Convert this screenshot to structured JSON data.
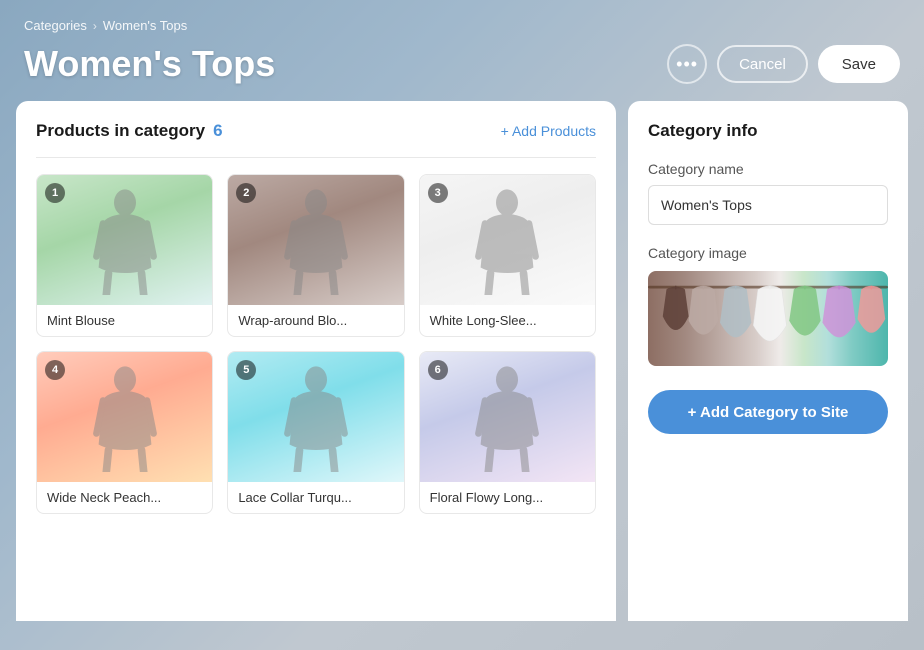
{
  "breadcrumb": {
    "parent": "Categories",
    "separator": "›",
    "current": "Women's Tops"
  },
  "page": {
    "title": "Women's Tops"
  },
  "header_actions": {
    "more_label": "•••",
    "cancel_label": "Cancel",
    "save_label": "Save"
  },
  "products_panel": {
    "title": "Products in category",
    "count": "6",
    "add_label": "+ Add Products"
  },
  "products": [
    {
      "id": 1,
      "number": "1",
      "name": "Mint Blouse",
      "img_class": "img-mint"
    },
    {
      "id": 2,
      "number": "2",
      "name": "Wrap-around Blo...",
      "img_class": "img-wrap"
    },
    {
      "id": 3,
      "number": "3",
      "name": "White Long-Slee...",
      "img_class": "img-white"
    },
    {
      "id": 4,
      "number": "4",
      "name": "Wide Neck Peach...",
      "img_class": "img-peach"
    },
    {
      "id": 5,
      "number": "5",
      "name": "Lace Collar Turqu...",
      "img_class": "img-turq"
    },
    {
      "id": 6,
      "number": "6",
      "name": "Floral Flowy Long...",
      "img_class": "img-floral"
    }
  ],
  "category_info": {
    "title": "Category info",
    "name_label": "Category name",
    "name_value": "Women's Tops",
    "image_label": "Category image",
    "add_btn_label": "+ Add Category to Site"
  }
}
